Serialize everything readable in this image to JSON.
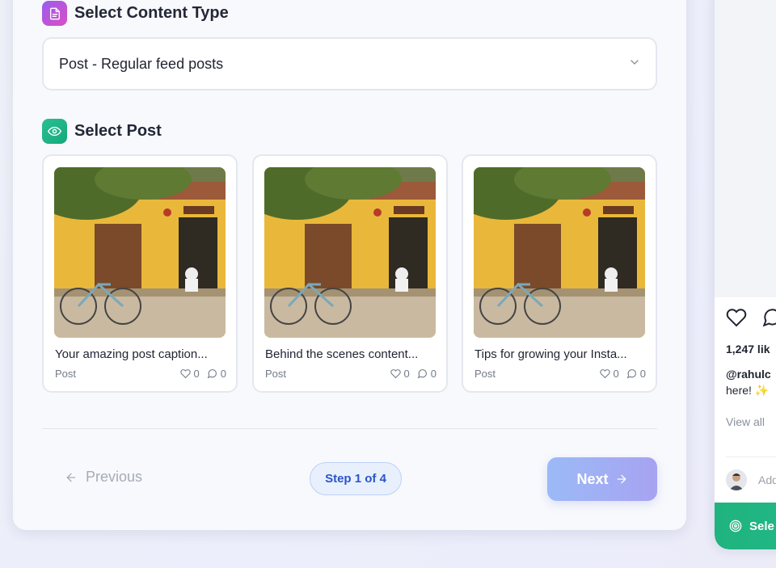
{
  "content_type": {
    "heading": "Select Content Type",
    "selected_value": "Post - Regular feed posts"
  },
  "post_section": {
    "heading": "Select Post",
    "posts": [
      {
        "caption": "Your amazing post caption...",
        "type": "Post",
        "likes": "0",
        "comments": "0"
      },
      {
        "caption": "Behind the scenes content...",
        "type": "Post",
        "likes": "0",
        "comments": "0"
      },
      {
        "caption": "Tips for growing your Insta...",
        "type": "Post",
        "likes": "0",
        "comments": "0"
      }
    ]
  },
  "footer": {
    "previous_label": "Previous",
    "step_label": "Step 1 of 4",
    "next_label": "Next"
  },
  "preview": {
    "likes": "1,247 lik",
    "username": "@rahulc",
    "caption": "here! ✨",
    "view_all": "View all",
    "add_comment": "Add",
    "select_label": "Sele"
  },
  "colors": {
    "accent_green": "#1fb37f",
    "accent_purple": "#9b5cf0",
    "step_blue": "#2a55c9"
  }
}
